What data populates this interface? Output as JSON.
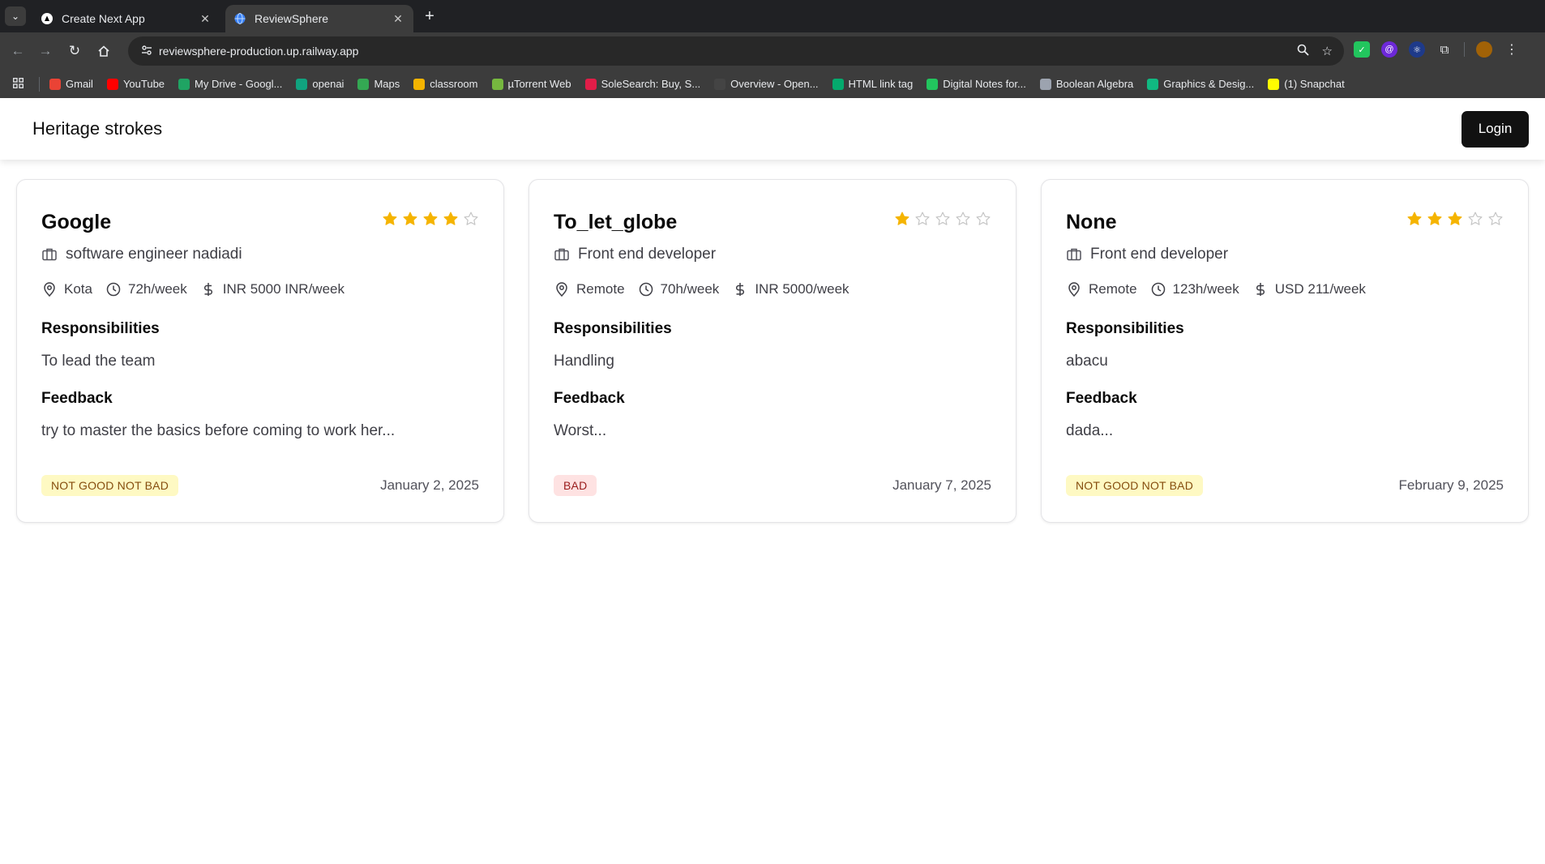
{
  "browser": {
    "tabs": [
      {
        "title": "Create Next App",
        "active": false
      },
      {
        "title": "ReviewSphere",
        "active": true
      }
    ],
    "url": "reviewsphere-production.up.railway.app",
    "bookmarks": [
      {
        "label": "Gmail",
        "icon": "gmail-icon",
        "color": "#ea4335"
      },
      {
        "label": "YouTube",
        "icon": "youtube-icon",
        "color": "#ff0000"
      },
      {
        "label": "My Drive - Googl...",
        "icon": "drive-icon",
        "color": "#1fa463"
      },
      {
        "label": "openai",
        "icon": "openai-icon",
        "color": "#10a37f"
      },
      {
        "label": "Maps",
        "icon": "maps-icon",
        "color": "#34a853"
      },
      {
        "label": "classroom",
        "icon": "classroom-icon",
        "color": "#f4b400"
      },
      {
        "label": "µTorrent Web",
        "icon": "utorrent-icon",
        "color": "#76b83f"
      },
      {
        "label": "SoleSearch: Buy, S...",
        "icon": "solesearch-icon",
        "color": "#e11d48"
      },
      {
        "label": "Overview - Open...",
        "icon": "openai-icon",
        "color": "#444444"
      },
      {
        "label": "HTML link tag",
        "icon": "w3schools-icon",
        "color": "#04aa6d"
      },
      {
        "label": "Digital Notes for...",
        "icon": "notes-icon",
        "color": "#22c55e"
      },
      {
        "label": "Boolean Algebra",
        "icon": "boolean-icon",
        "color": "#9ca3af"
      },
      {
        "label": "Graphics & Desig...",
        "icon": "graphics-icon",
        "color": "#10b981"
      },
      {
        "label": "(1) Snapchat",
        "icon": "snapchat-icon",
        "color": "#fffc00"
      }
    ]
  },
  "header": {
    "brand": "Heritage strokes",
    "login_label": "Login"
  },
  "colors": {
    "star_filled": "#f5b400",
    "star_empty": "#c4c4c4"
  },
  "reviews": [
    {
      "company": "Google",
      "rating": 4,
      "role": "software engineer nadiadi",
      "location": "Kota",
      "hours": "72h/week",
      "pay": "INR 5000 INR/week",
      "responsibilities_title": "Responsibilities",
      "responsibilities": "To lead the team",
      "feedback_title": "Feedback",
      "feedback": "try to master the basics before coming to work her...",
      "badge": "NOT GOOD NOT BAD",
      "badge_type": "neutral",
      "date": "January 2, 2025"
    },
    {
      "company": "To_let_globe",
      "rating": 1,
      "role": "Front end developer",
      "location": "Remote",
      "hours": "70h/week",
      "pay": "INR 5000/week",
      "responsibilities_title": "Responsibilities",
      "responsibilities": "Handling",
      "feedback_title": "Feedback",
      "feedback": "Worst...",
      "badge": "BAD",
      "badge_type": "bad",
      "date": "January 7, 2025"
    },
    {
      "company": "None",
      "rating": 3,
      "role": "Front end developer",
      "location": "Remote",
      "hours": "123h/week",
      "pay": "USD 211/week",
      "responsibilities_title": "Responsibilities",
      "responsibilities": "abacu",
      "feedback_title": "Feedback",
      "feedback": "dada...",
      "badge": "NOT GOOD NOT BAD",
      "badge_type": "neutral",
      "date": "February 9, 2025"
    }
  ]
}
